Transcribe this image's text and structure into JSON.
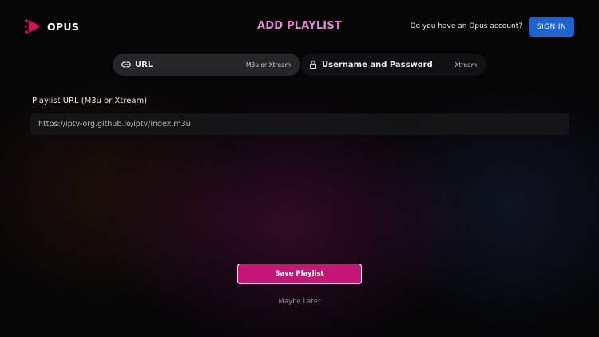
{
  "header": {
    "brand": "OPUS",
    "logo_icon": "play-triangle-icon",
    "title": "ADD PLAYLIST",
    "account_prompt": "Do you have an Opus account?",
    "sign_in_label": "SIGN IN"
  },
  "tabs": [
    {
      "label": "URL",
      "hint": "M3u or Xtream",
      "icon": "link-icon",
      "selected": true
    },
    {
      "label": "Username and Password",
      "hint": "Xtream",
      "icon": "lock-icon",
      "selected": false
    }
  ],
  "form": {
    "url_label": "Playlist URL (M3u or Xtream)",
    "url_value": "https://iptv-org.github.io/iptv/index.m3u"
  },
  "actions": {
    "save_label": "Save Playlist",
    "later_label": "Maybe Later"
  },
  "colors": {
    "title": "#e988d6",
    "sign_in_button": "#1f64ce",
    "save_button": "#c81678",
    "brand_accent": "#d4145a"
  }
}
